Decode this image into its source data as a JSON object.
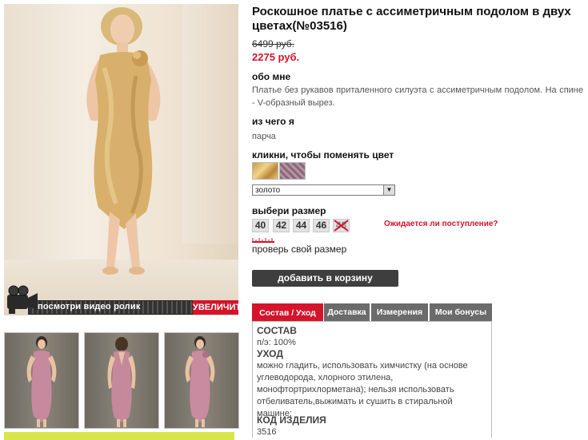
{
  "product": {
    "title": "Роскошное платье с ассиметричным подолом в двух цветах(№03516)",
    "old_price": "6499 руб.",
    "new_price": "2275 руб."
  },
  "gallery": {
    "video_label": "посмотри видео ролик",
    "zoom_label": "УВЕЛИЧИТЬ",
    "thumb_count": 3
  },
  "about": {
    "heading": "обо мне",
    "text": "Платье без рукавов приталенного силуэта с ассиметричным подолом. На спине - V-образный вырез."
  },
  "material": {
    "heading": "из чего я",
    "text": "парча"
  },
  "color": {
    "heading": "кликни, чтобы поменять цвет",
    "selected": "золото",
    "swatches": [
      "gold",
      "pink"
    ]
  },
  "size": {
    "heading": "выбери размер",
    "options": [
      "40",
      "42",
      "44",
      "46",
      "48"
    ],
    "unavailable": "48",
    "waiting_link": "Ожидается ли поступление?",
    "check_link": "проверь свой размер"
  },
  "cart": {
    "button_label": "добавить в корзину"
  },
  "tabs": [
    "Состав / Уход",
    "Доставка",
    "Измерения",
    "Мои бонусы"
  ],
  "panel": {
    "composition_heading": "СОСТАВ",
    "composition_value": "п/э: 100%",
    "care_heading": "УХОД",
    "care_text": "можно гладить, использовать химчистку (на основе углеводорода, хлорного этилена, монофтортрихлорметана); нельзя использовать отбеливатель,выжимать и сушить в стиральной машине;",
    "code_heading": "КОД ИЗДЕЛИЯ",
    "code_value": "3516"
  },
  "colors": {
    "accent": "#d4142b",
    "button_dark": "#3e3e3e",
    "tab_gray": "#6b6b6b"
  }
}
